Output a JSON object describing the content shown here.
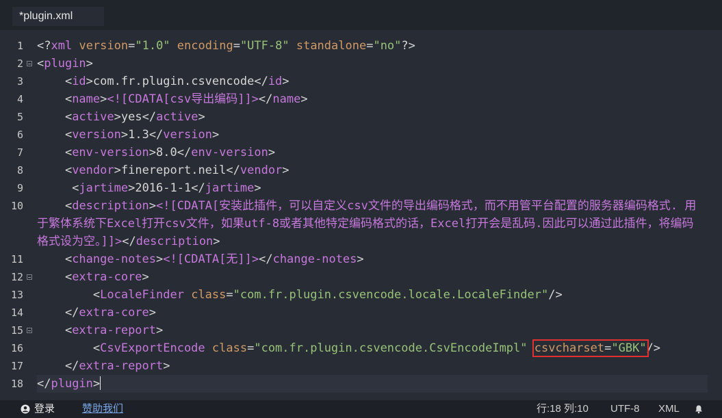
{
  "tab": {
    "title": "*plugin.xml"
  },
  "gutter": [
    "1",
    "2",
    "3",
    "4",
    "5",
    "6",
    "7",
    "8",
    "9",
    "10",
    "11",
    "12",
    "13",
    "14",
    "15",
    "16",
    "17",
    "18"
  ],
  "code": {
    "l1": {
      "a": "<?",
      "b": "xml",
      "c": " ",
      "d": "version",
      "e": "=",
      "f": "\"1.0\"",
      "g": " ",
      "h": "encoding",
      "i": "=",
      "j": "\"UTF-8\"",
      "k": " ",
      "l": "standalone",
      "m": "=",
      "n": "\"no\"",
      "o": "?>"
    },
    "l2": {
      "a": "<",
      "b": "plugin",
      "c": ">"
    },
    "l3": {
      "a": "    <",
      "b": "id",
      "c": ">",
      "d": "com.fr.plugin.csvencode",
      "e": "</",
      "f": "id",
      "g": ">"
    },
    "l4": {
      "a": "    <",
      "b": "name",
      "c": ">",
      "d": "<![CDATA[csv导出编码]]>",
      "e": "</",
      "f": "name",
      "g": ">"
    },
    "l5": {
      "a": "    <",
      "b": "active",
      "c": ">",
      "d": "yes",
      "e": "</",
      "f": "active",
      "g": ">"
    },
    "l6": {
      "a": "    <",
      "b": "version",
      "c": ">",
      "d": "1.3",
      "e": "</",
      "f": "version",
      "g": ">"
    },
    "l7": {
      "a": "    <",
      "b": "env-version",
      "c": ">",
      "d": "8.0",
      "e": "</",
      "f": "env-version",
      "g": ">"
    },
    "l8": {
      "a": "    <",
      "b": "vendor",
      "c": ">",
      "d": "finereport.neil",
      "e": "</",
      "f": "vendor",
      "g": ">"
    },
    "l9": {
      "a": "     <",
      "b": "jartime",
      "c": ">",
      "d": "2016-1-1",
      "e": "</",
      "f": "jartime",
      "g": ">"
    },
    "l10": {
      "a": "    <",
      "b": "description",
      "c": ">",
      "d": "<![CDATA[安装此插件，可以自定义csv文件的导出编码格式，而不用管平台配置的服务器编码格式. 用于繁体系统下Excel打开csv文件，如果utf-8或者其他特定编码格式的话，Excel打开会是乱码.因此可以通过此插件，将编码格式设为空。]]>",
      "e": "</",
      "f": "description",
      "g": ">"
    },
    "l11": {
      "a": "    <",
      "b": "change-notes",
      "c": ">",
      "d": "<![CDATA[无]]>",
      "e": "</",
      "f": "change-notes",
      "g": ">"
    },
    "l12": {
      "a": "    <",
      "b": "extra-core",
      "c": ">"
    },
    "l13": {
      "a": "        <",
      "b": "LocaleFinder",
      "c": " ",
      "d": "class",
      "e": "=",
      "f": "\"com.fr.plugin.csvencode.locale.LocaleFinder\"",
      "g": "/>"
    },
    "l14": {
      "a": "    </",
      "b": "extra-core",
      "c": ">"
    },
    "l15": {
      "a": "    <",
      "b": "extra-report",
      "c": ">"
    },
    "l16": {
      "a": "        <",
      "b": "CsvExportEncode",
      "c": " ",
      "d": "class",
      "e": "=",
      "f": "\"com.fr.plugin.csvencode.CsvEncodeImpl\"",
      "g": " ",
      "h": "csvcharset",
      "i": "=",
      "j": "\"GBK\"",
      "k": "/>"
    },
    "l17": {
      "a": "    </",
      "b": "extra-report",
      "c": ">"
    },
    "l18": {
      "a": "</",
      "b": "plugin",
      "c": ">"
    }
  },
  "status": {
    "login": "登录",
    "donate": "赞助我们",
    "position": "行:18  列:10",
    "encoding": "UTF-8",
    "language": "XML"
  }
}
